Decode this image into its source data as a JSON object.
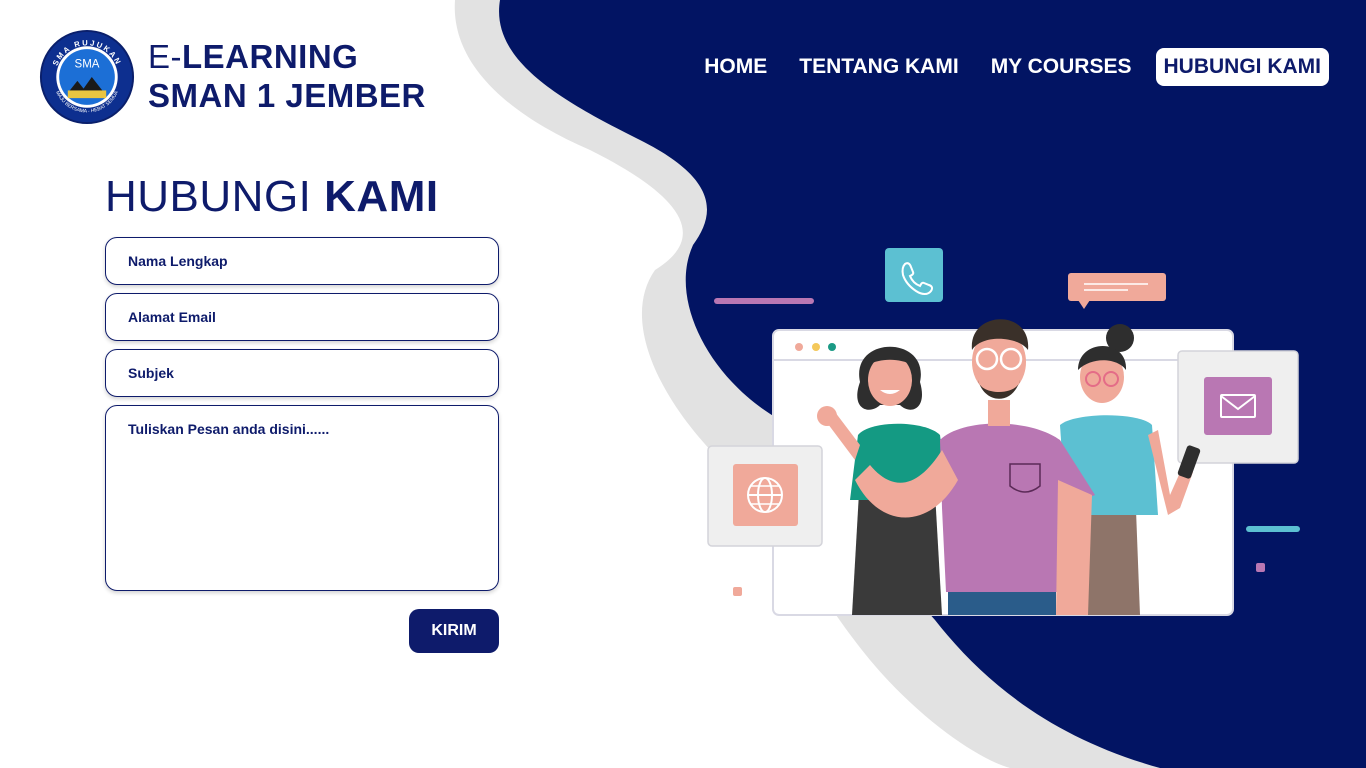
{
  "brand": {
    "logo_alt": "SMA Rujukan logo",
    "logo_texts": {
      "top": "SMA RUJUKAN",
      "center": "SMA",
      "bottom": "MAJU BERSAMA - HEBAT SEMUA"
    },
    "line1_prefix": "E-",
    "line1_rest": "LEARNING",
    "line2": "SMAN 1 JEMBER"
  },
  "nav": {
    "items": [
      {
        "label": "HOME",
        "active": false
      },
      {
        "label": "TENTANG KAMI",
        "active": false
      },
      {
        "label": "MY COURSES",
        "active": false
      },
      {
        "label": "HUBUNGI KAMI",
        "active": true
      }
    ]
  },
  "page": {
    "title_light": "HUBUNGI",
    "title_bold": "KAMI"
  },
  "form": {
    "name_placeholder": "Nama Lengkap",
    "email_placeholder": "Alamat Email",
    "subject_placeholder": "Subjek",
    "message_placeholder": "Tuliskan Pesan anda disini......",
    "submit_label": "KIRIM"
  },
  "colors": {
    "primary": "#0e1b6b",
    "blob": "#021463",
    "wave": "#e2e2e2",
    "purple": "#b977b3",
    "teal": "#5cc0d2",
    "salmon": "#f0a99a"
  },
  "illustration": {
    "icons": [
      "phone-icon",
      "chat-bubble-icon",
      "mail-icon",
      "globe-icon"
    ]
  }
}
